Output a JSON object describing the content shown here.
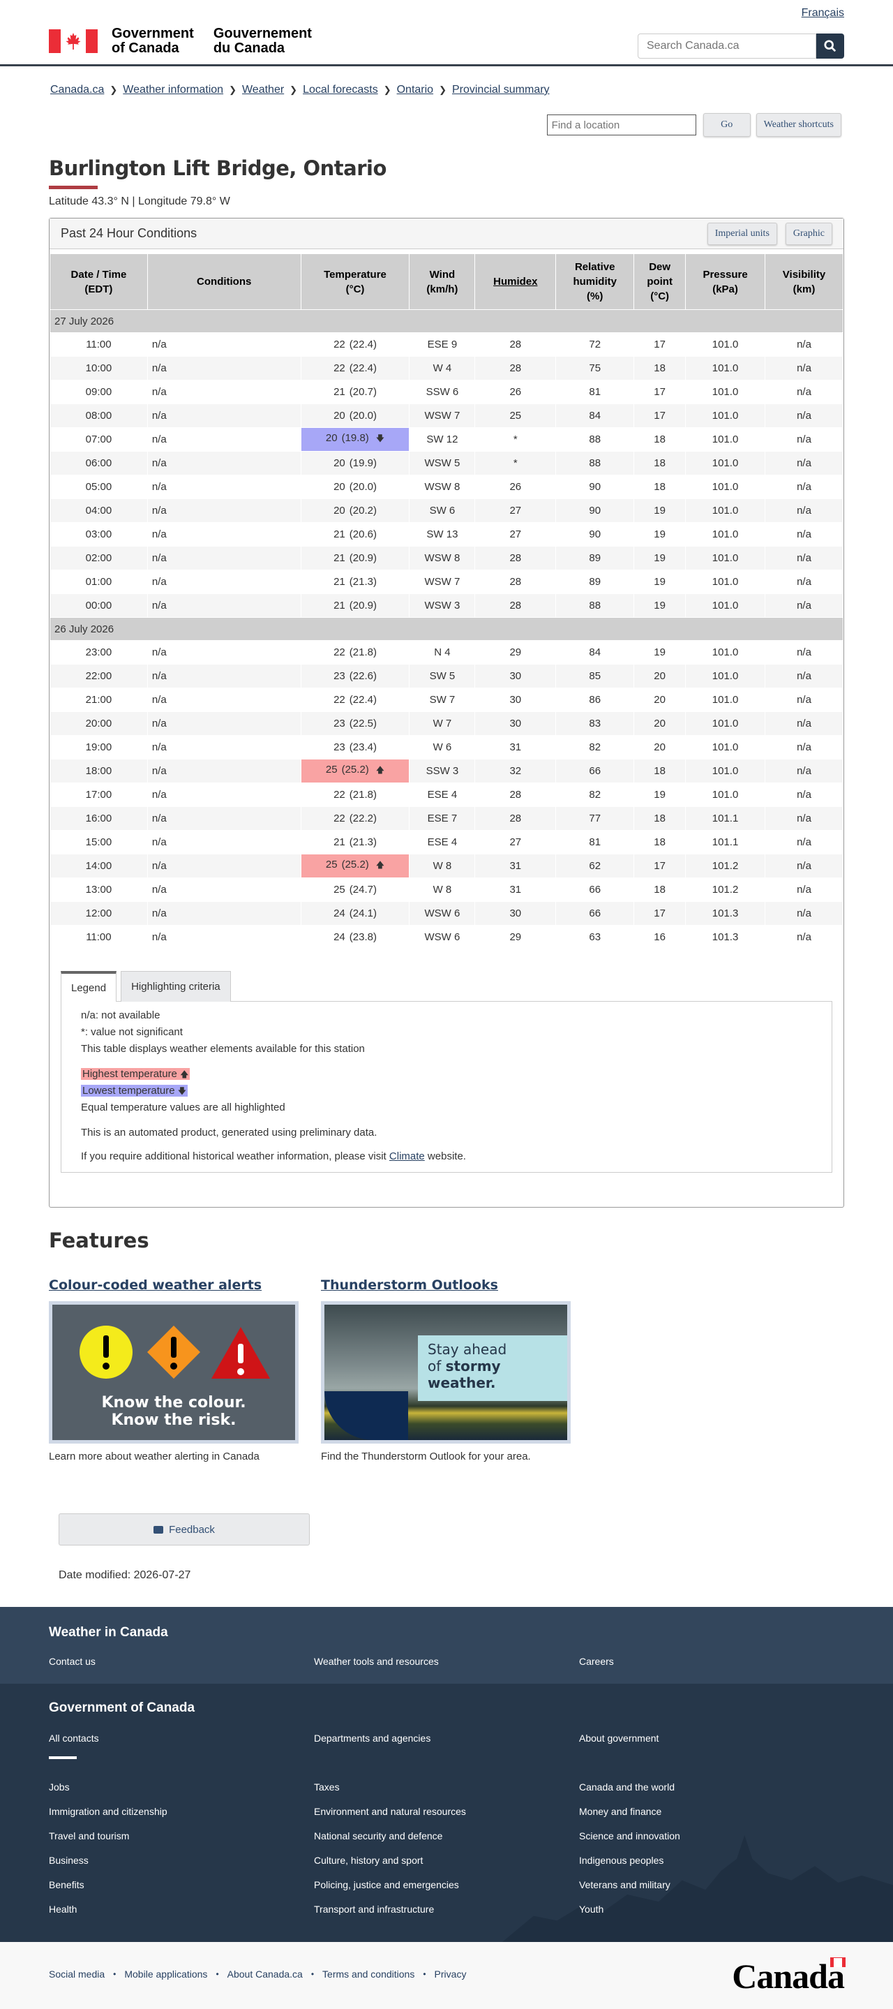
{
  "header": {
    "lang_link": "Français",
    "gov_en": [
      "Government",
      "of Canada"
    ],
    "gov_fr": [
      "Gouvernement",
      "du Canada"
    ],
    "search_placeholder": "Search Canada.ca"
  },
  "breadcrumb": [
    "Canada.ca",
    "Weather information",
    "Weather",
    "Local forecasts",
    "Ontario",
    "Provincial summary"
  ],
  "tools": {
    "location_placeholder": "Find a location",
    "go": "Go",
    "shortcuts": "Weather shortcuts"
  },
  "page": {
    "title": "Burlington Lift Bridge, Ontario",
    "latlon": "Latitude 43.3° N | Longitude 79.8° W"
  },
  "panel": {
    "title": "Past 24 Hour Conditions",
    "imperial": "Imperial units",
    "graphic": "Graphic"
  },
  "table": {
    "headers": [
      "Date / Time\n(EDT)",
      "Conditions",
      "Temperature\n(°C)",
      "Wind\n(km/h)",
      "Humidex",
      "Relative\nhumidity\n(%)",
      "Dew\npoint\n(°C)",
      "Pressure\n(kPa)",
      "Visibility\n(km)"
    ],
    "groups": [
      {
        "date": "27 July 2026",
        "rows": [
          [
            "11:00",
            "n/a",
            "22",
            "(22.4)",
            "ESE 9",
            "28",
            "72",
            "17",
            "101.0",
            "n/a",
            ""
          ],
          [
            "10:00",
            "n/a",
            "22",
            "(22.4)",
            "W 4",
            "28",
            "75",
            "18",
            "101.0",
            "n/a",
            ""
          ],
          [
            "09:00",
            "n/a",
            "21",
            "(20.7)",
            "SSW 6",
            "26",
            "81",
            "17",
            "101.0",
            "n/a",
            ""
          ],
          [
            "08:00",
            "n/a",
            "20",
            "(20.0)",
            "WSW 7",
            "25",
            "84",
            "17",
            "101.0",
            "n/a",
            ""
          ],
          [
            "07:00",
            "n/a",
            "20",
            "(19.8)",
            "SW 12",
            "*",
            "88",
            "18",
            "101.0",
            "n/a",
            "lo"
          ],
          [
            "06:00",
            "n/a",
            "20",
            "(19.9)",
            "WSW 5",
            "*",
            "88",
            "18",
            "101.0",
            "n/a",
            ""
          ],
          [
            "05:00",
            "n/a",
            "20",
            "(20.0)",
            "WSW 8",
            "26",
            "90",
            "18",
            "101.0",
            "n/a",
            ""
          ],
          [
            "04:00",
            "n/a",
            "20",
            "(20.2)",
            "SW 6",
            "27",
            "90",
            "19",
            "101.0",
            "n/a",
            ""
          ],
          [
            "03:00",
            "n/a",
            "21",
            "(20.6)",
            "SW 13",
            "27",
            "90",
            "19",
            "101.0",
            "n/a",
            ""
          ],
          [
            "02:00",
            "n/a",
            "21",
            "(20.9)",
            "WSW 8",
            "28",
            "89",
            "19",
            "101.0",
            "n/a",
            ""
          ],
          [
            "01:00",
            "n/a",
            "21",
            "(21.3)",
            "WSW 7",
            "28",
            "89",
            "19",
            "101.0",
            "n/a",
            ""
          ],
          [
            "00:00",
            "n/a",
            "21",
            "(20.9)",
            "WSW 3",
            "28",
            "88",
            "19",
            "101.0",
            "n/a",
            ""
          ]
        ]
      },
      {
        "date": "26 July 2026",
        "rows": [
          [
            "23:00",
            "n/a",
            "22",
            "(21.8)",
            "N 4",
            "29",
            "84",
            "19",
            "101.0",
            "n/a",
            ""
          ],
          [
            "22:00",
            "n/a",
            "23",
            "(22.6)",
            "SW 5",
            "30",
            "85",
            "20",
            "101.0",
            "n/a",
            ""
          ],
          [
            "21:00",
            "n/a",
            "22",
            "(22.4)",
            "SW 7",
            "30",
            "86",
            "20",
            "101.0",
            "n/a",
            ""
          ],
          [
            "20:00",
            "n/a",
            "23",
            "(22.5)",
            "W 7",
            "30",
            "83",
            "20",
            "101.0",
            "n/a",
            ""
          ],
          [
            "19:00",
            "n/a",
            "23",
            "(23.4)",
            "W 6",
            "31",
            "82",
            "20",
            "101.0",
            "n/a",
            ""
          ],
          [
            "18:00",
            "n/a",
            "25",
            "(25.2)",
            "SSW 3",
            "32",
            "66",
            "18",
            "101.0",
            "n/a",
            "hi"
          ],
          [
            "17:00",
            "n/a",
            "22",
            "(21.8)",
            "ESE 4",
            "28",
            "82",
            "19",
            "101.0",
            "n/a",
            ""
          ],
          [
            "16:00",
            "n/a",
            "22",
            "(22.2)",
            "ESE 7",
            "28",
            "77",
            "18",
            "101.1",
            "n/a",
            ""
          ],
          [
            "15:00",
            "n/a",
            "21",
            "(21.3)",
            "ESE 4",
            "27",
            "81",
            "18",
            "101.1",
            "n/a",
            ""
          ],
          [
            "14:00",
            "n/a",
            "25",
            "(25.2)",
            "W 8",
            "31",
            "62",
            "17",
            "101.2",
            "n/a",
            "hi"
          ],
          [
            "13:00",
            "n/a",
            "25",
            "(24.7)",
            "W 8",
            "31",
            "66",
            "18",
            "101.2",
            "n/a",
            ""
          ],
          [
            "12:00",
            "n/a",
            "24",
            "(24.1)",
            "WSW 6",
            "30",
            "66",
            "17",
            "101.3",
            "n/a",
            ""
          ],
          [
            "11:00",
            "n/a",
            "24",
            "(23.8)",
            "WSW 6",
            "29",
            "63",
            "16",
            "101.3",
            "n/a",
            ""
          ]
        ]
      }
    ]
  },
  "legend": {
    "tab_legend": "Legend",
    "tab_criteria": "Highlighting criteria",
    "na": "n/a: not available",
    "star": "*: value not significant",
    "avail": "This table displays weather elements available for this station",
    "highest": "Highest temperature",
    "lowest": "Lowest temperature",
    "equal": "Equal temperature values are all highlighted",
    "auto": "This is an automated product, generated using preliminary data.",
    "climate_pre": "If you require additional historical weather information, please visit ",
    "climate_link": "Climate",
    "climate_post": " website."
  },
  "features": {
    "title": "Features",
    "f1": {
      "title": "Colour-coded weather alerts",
      "img_text": [
        "Know the colour.",
        "Know the risk."
      ],
      "caption": "Learn more about weather alerting in Canada"
    },
    "f2": {
      "title": "Thunderstorm Outlooks",
      "img_text": [
        "Stay ahead",
        "of",
        "stormy",
        "weather."
      ],
      "caption": "Find the Thunderstorm Outlook for your area."
    }
  },
  "feedback": "Feedback",
  "date_modified": "Date modified: 2026-07-27",
  "footer": {
    "weather_title": "Weather in Canada",
    "weather_links": [
      "Contact us",
      "Weather tools and resources",
      "Careers"
    ],
    "gov_title": "Government of Canada",
    "gov_links": [
      "All contacts",
      "Departments and agencies",
      "About government"
    ],
    "theme_links": [
      [
        "Jobs",
        "Taxes",
        "Canada and the world"
      ],
      [
        "Immigration and citizenship",
        "Environment and natural resources",
        "Money and finance"
      ],
      [
        "Travel and tourism",
        "National security and defence",
        "Science and innovation"
      ],
      [
        "Business",
        "Culture, history and sport",
        "Indigenous peoples"
      ],
      [
        "Benefits",
        "Policing, justice and emergencies",
        "Veterans and military"
      ],
      [
        "Health",
        "Transport and infrastructure",
        "Youth"
      ]
    ],
    "bottom_links": [
      "Social media",
      "Mobile applications",
      "About Canada.ca",
      "Terms and conditions",
      "Privacy"
    ],
    "wordmark": "Canada"
  }
}
